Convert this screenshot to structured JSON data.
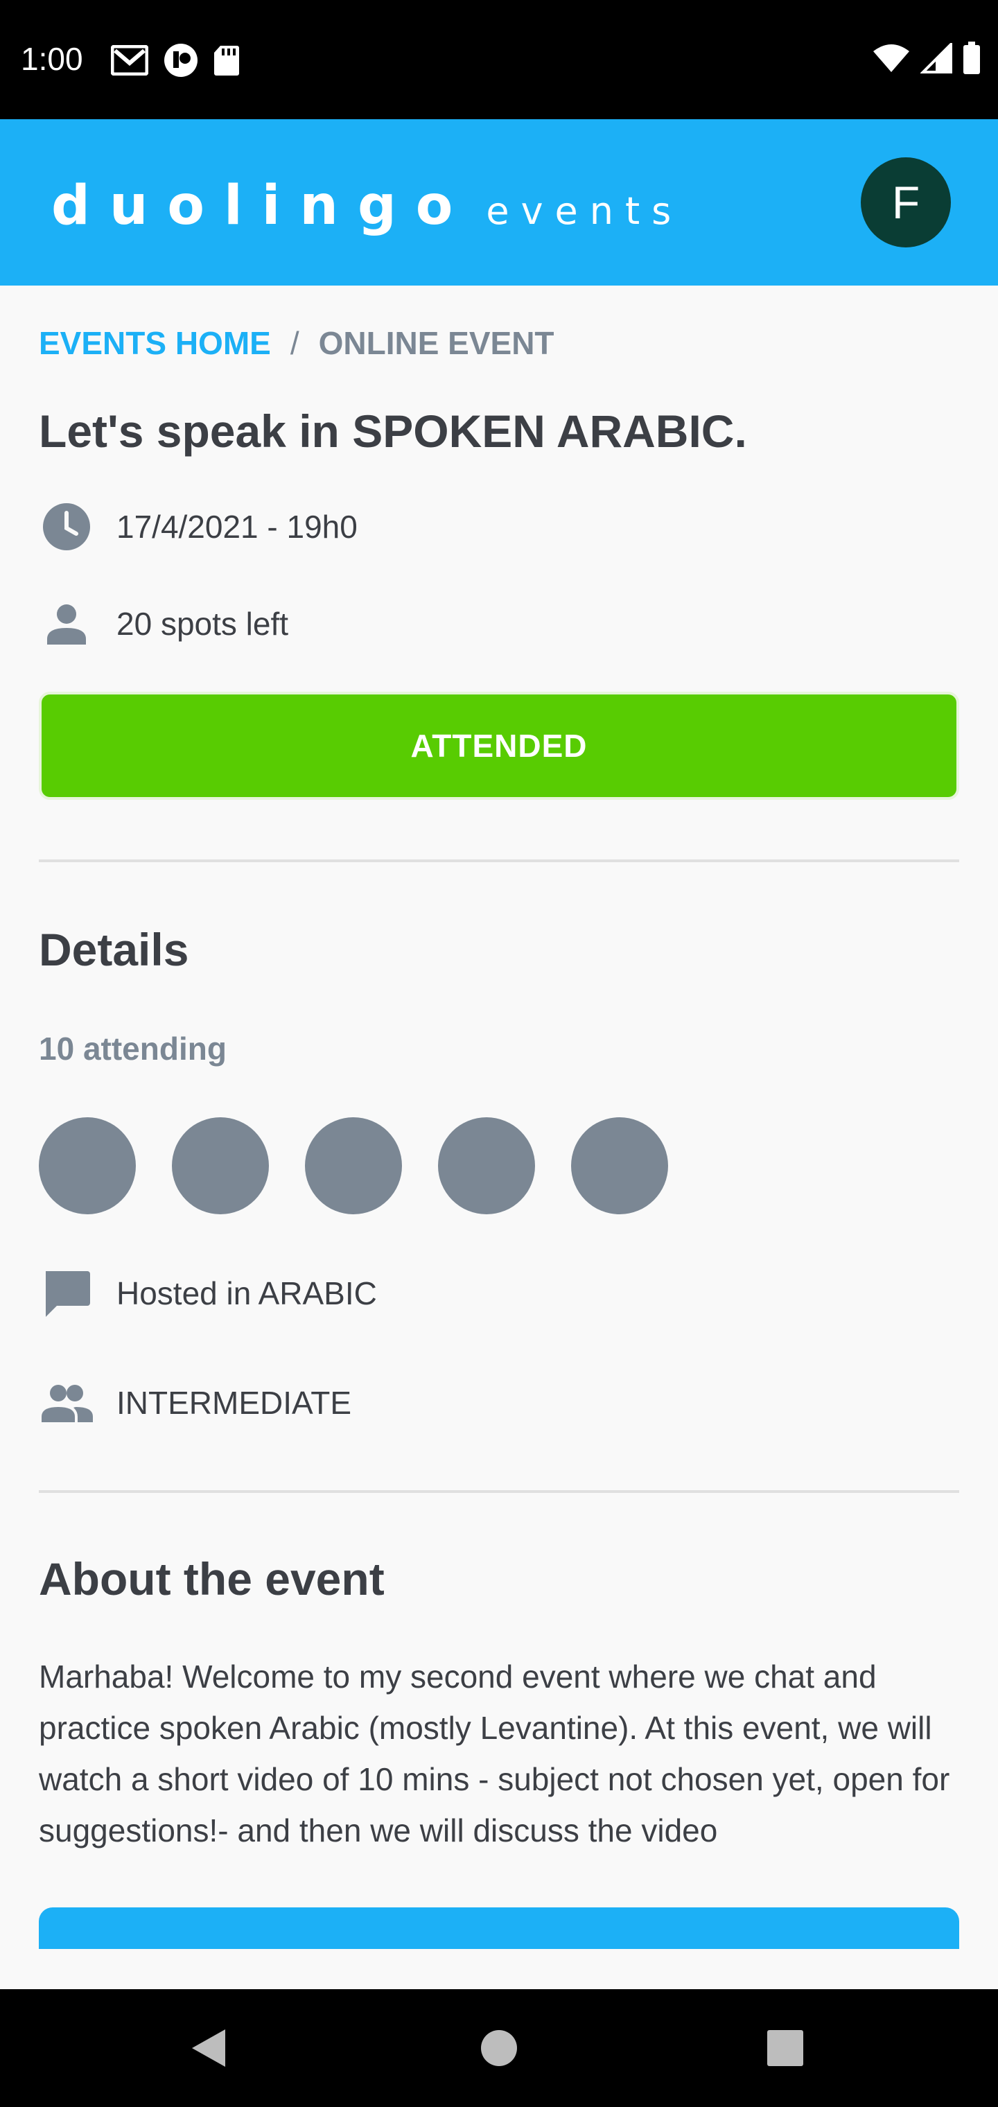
{
  "status_bar": {
    "time": "1:00",
    "left_icons": [
      "gmail-icon",
      "app-icon",
      "sd-card-icon"
    ],
    "right_icons": [
      "wifi-icon",
      "cell-signal-icon",
      "battery-icon"
    ]
  },
  "header": {
    "brand_main": "duolingo",
    "brand_sub": "events",
    "avatar_letter": "F",
    "background_color": "#1cb0f6",
    "avatar_color": "#0a3d34"
  },
  "breadcrumb": {
    "home": "EVENTS HOME",
    "separator": "/",
    "current": "ONLINE EVENT"
  },
  "event": {
    "title": "Let's speak in SPOKEN ARABIC.",
    "datetime": "17/4/2021 - 19h0",
    "spots": "20 spots left",
    "button_label": "ATTENDED",
    "button_color": "#58cc02"
  },
  "details": {
    "heading": "Details",
    "attending": "10 attending",
    "attendee_count_shown": 5,
    "language": "Hosted in ARABIC",
    "level": "INTERMEDIATE"
  },
  "about": {
    "heading": "About the event",
    "text": "Marhaba! Welcome to my second event where we chat and practice spoken Arabic (mostly Levantine). At this event, we will watch a short video of 10 mins - subject not chosen yet, open for suggestions!- and then we will discuss the video"
  },
  "nav": {
    "icons": [
      "back-icon",
      "home-icon",
      "recents-icon"
    ]
  }
}
